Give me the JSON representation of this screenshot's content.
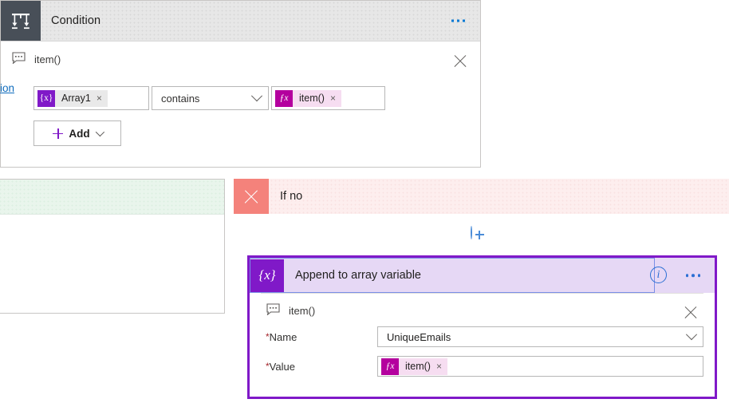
{
  "condition_card": {
    "icon": "condition-branch-icon",
    "title": "Condition",
    "menu_icon": "ellipsis-icon",
    "comment": {
      "icon": "comment-bubble-icon",
      "text": "item()",
      "close_icon": "close-icon"
    },
    "row": {
      "left_operand": {
        "badge": "{x}",
        "badge_icon": "variable-token-icon",
        "label": "Array1",
        "remove_icon": "×"
      },
      "operator": {
        "value": "contains",
        "chevron_icon": "chevron-down-icon"
      },
      "right_operand": {
        "badge": "ƒx",
        "badge_icon": "expression-token-icon",
        "label": "item()",
        "remove_icon": "×"
      }
    },
    "add_button": {
      "plus_icon": "plus-icon",
      "label": "Add",
      "chevron_icon": "chevron-down-icon"
    }
  },
  "if_yes_branch": {
    "action_link": "action"
  },
  "if_no_branch": {
    "icon": "x-mark-icon",
    "title": "If no",
    "add_step_icon": "circle-plus-icon"
  },
  "append_card": {
    "icon": "{x}",
    "icon_name": "variable-icon",
    "title": "Append to array variable",
    "info_icon": "info-circle-icon",
    "menu_icon": "ellipsis-icon",
    "comment": {
      "icon": "comment-bubble-icon",
      "text": "item()",
      "close_icon": "close-icon"
    },
    "fields": [
      {
        "required_marker": "*",
        "label": "Name",
        "value": "UniqueEmails",
        "chevron_icon": "chevron-down-icon",
        "type": "dropdown"
      },
      {
        "required_marker": "*",
        "label": "Value",
        "type": "token",
        "token": {
          "badge": "ƒx",
          "badge_icon": "expression-token-icon",
          "label": "item()",
          "remove_icon": "×"
        }
      }
    ]
  },
  "colors": {
    "variable_purple": "#8019c8",
    "expression_magenta": "#b4009e",
    "expression_bg": "#f6ddf1",
    "if_no_coral": "#f4827b",
    "if_no_header_bg": "#fdeeee",
    "if_yes_header_bg": "#e9f5ec",
    "append_header_bg": "#e6d8f5",
    "accent_blue": "#0078d4",
    "condition_icon_bg": "#484f58"
  }
}
